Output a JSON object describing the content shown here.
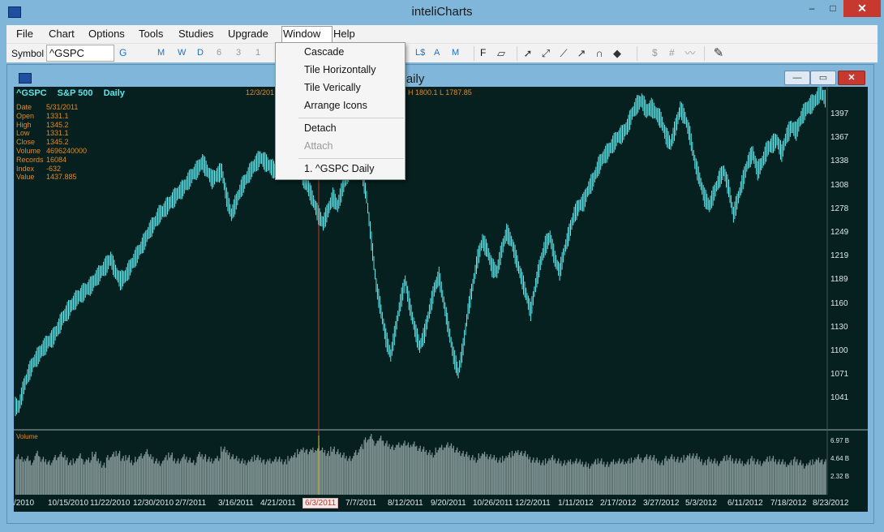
{
  "window": {
    "title": "inteliCharts",
    "minimize": "–",
    "maximize": "□",
    "close": "✕"
  },
  "menu": [
    "File",
    "Chart",
    "Options",
    "Tools",
    "Studies",
    "Upgrade",
    "Window",
    "Help"
  ],
  "toolbar": {
    "symbol_label": "Symbol",
    "symbol_value": "^GSPC",
    "go": "G",
    "periods": [
      "M",
      "W",
      "D"
    ],
    "intervals": [
      "6",
      "3",
      "1"
    ],
    "scale_buttons": [
      "L$",
      "A",
      "M"
    ],
    "format_button": "F",
    "money_button": "$",
    "number_button": "#"
  },
  "chart_window": {
    "title": "C Daily",
    "min": "—",
    "restore": "▭",
    "close": "✕"
  },
  "window_menu": {
    "items": [
      "Cascade",
      "Tile Horizontally",
      "Tile Verically",
      "Arrange Icons",
      "Detach",
      "Attach",
      "1. ^GSPC Daily"
    ],
    "disabled": [
      "Attach"
    ]
  },
  "chart_header": {
    "symbol": "^GSPC",
    "name": "S&P 500",
    "period": "Daily",
    "date_fragment": "12/3/201",
    "ohlc_fragment": "H 1800.1  L 1787.85"
  },
  "info": [
    {
      "key": "Date",
      "value": "5/31/2011"
    },
    {
      "key": "Open",
      "value": "1331.1"
    },
    {
      "key": "High",
      "value": "1345.2"
    },
    {
      "key": "Low",
      "value": "1331.1"
    },
    {
      "key": "Close",
      "value": "1345.2"
    },
    {
      "key": "Volume",
      "value": "4696240000"
    },
    {
      "key": "Records",
      "value": "16084"
    },
    {
      "key": "Index",
      "value": "-632"
    },
    {
      "key": "Value",
      "value": "1437.885"
    }
  ],
  "volume_label": "Volume",
  "chart_data": {
    "type": "bar",
    "y_ticks": [
      "1397",
      "1367",
      "1338",
      "1308",
      "1278",
      "1249",
      "1219",
      "1189",
      "1160",
      "1130",
      "1100",
      "1071",
      "1041"
    ],
    "volume_ticks": [
      "6.97 B",
      "4.64 B",
      "2.32 B"
    ],
    "x_ticks": [
      "/2010",
      "10/15/2010",
      "11/22/2010",
      "12/30/2010",
      "2/7/2011",
      "3/16/2011",
      "4/21/2011",
      "6/3/2011",
      "7/7/2011",
      "8/12/2011",
      "9/20/2011",
      "10/26/2011",
      "12/2/2011",
      "1/11/2012",
      "2/17/2012",
      "3/27/2012",
      "5/3/2012",
      "6/11/2012",
      "7/18/2012",
      "8/23/2012"
    ],
    "highlighted_x": "6/3/2011",
    "price_series": [
      1062,
      1085,
      1100,
      1112,
      1120,
      1128,
      1135,
      1140,
      1150,
      1162,
      1170,
      1178,
      1185,
      1190,
      1195,
      1200,
      1208,
      1215,
      1222,
      1230,
      1215,
      1205,
      1210,
      1220,
      1230,
      1240,
      1250,
      1262,
      1270,
      1280,
      1285,
      1292,
      1298,
      1305,
      1310,
      1318,
      1326,
      1332,
      1340,
      1330,
      1320,
      1325,
      1330,
      1300,
      1280,
      1295,
      1310,
      1320,
      1330,
      1338,
      1345,
      1340,
      1335,
      1330,
      1340,
      1345,
      1350,
      1345,
      1338,
      1320,
      1310,
      1295,
      1280,
      1270,
      1285,
      1300,
      1290,
      1310,
      1325,
      1338,
      1344,
      1330,
      1300,
      1250,
      1200,
      1170,
      1140,
      1120,
      1150,
      1180,
      1205,
      1175,
      1150,
      1130,
      1145,
      1170,
      1195,
      1210,
      1180,
      1150,
      1120,
      1100,
      1130,
      1170,
      1200,
      1230,
      1250,
      1240,
      1220,
      1215,
      1240,
      1260,
      1250,
      1230,
      1210,
      1190,
      1170,
      1200,
      1225,
      1245,
      1255,
      1230,
      1215,
      1240,
      1260,
      1280,
      1290,
      1295,
      1310,
      1320,
      1335,
      1345,
      1352,
      1360,
      1368,
      1372,
      1380,
      1395,
      1405,
      1410,
      1398,
      1402,
      1395,
      1388,
      1370,
      1360,
      1380,
      1400,
      1390,
      1370,
      1340,
      1320,
      1300,
      1290,
      1305,
      1320,
      1330,
      1310,
      1280,
      1300,
      1320,
      1340,
      1350,
      1330,
      1340,
      1355,
      1360,
      1365,
      1350,
      1370,
      1380,
      1375,
      1390,
      1400,
      1405,
      1410,
      1420,
      1412
    ],
    "volume_series": [
      4.6,
      4.1,
      4.3,
      3.9,
      4.8,
      4.2,
      4.0,
      3.7,
      4.4,
      4.9,
      4.3,
      3.8,
      4.1,
      4.5,
      3.9,
      4.2,
      4.7,
      4.0,
      3.6,
      4.3,
      4.8,
      5.0,
      4.2,
      4.4,
      3.9,
      4.1,
      4.6,
      5.2,
      4.4,
      4.0,
      3.8,
      4.3,
      4.7,
      4.1,
      3.9,
      4.5,
      4.2,
      3.7,
      4.8,
      4.6,
      4.1,
      4.0,
      4.4,
      5.3,
      5.0,
      4.6,
      4.2,
      4.0,
      3.9,
      4.1,
      4.4,
      4.2,
      3.8,
      4.0,
      4.3,
      4.1,
      3.9,
      4.4,
      4.6,
      5.1,
      5.4,
      5.0,
      5.3,
      5.6,
      5.2,
      4.9,
      5.5,
      5.0,
      4.7,
      4.4,
      4.2,
      5.0,
      5.8,
      6.4,
      6.9,
      6.2,
      6.6,
      6.1,
      5.8,
      5.5,
      5.9,
      6.2,
      5.8,
      6.0,
      5.6,
      5.3,
      5.0,
      4.8,
      5.2,
      5.6,
      6.0,
      5.7,
      5.3,
      5.0,
      4.7,
      4.4,
      4.2,
      4.5,
      4.8,
      4.6,
      4.3,
      4.1,
      4.4,
      4.6,
      4.9,
      5.1,
      4.8,
      4.5,
      4.2,
      4.0,
      3.8,
      4.1,
      4.3,
      4.0,
      3.8,
      3.7,
      3.9,
      4.1,
      3.8,
      3.6,
      3.5,
      3.8,
      4.0,
      3.7,
      3.5,
      3.9,
      4.1,
      3.8,
      4.0,
      4.2,
      4.4,
      4.1,
      4.6,
      4.3,
      4.0,
      3.9,
      4.2,
      4.5,
      4.3,
      4.0,
      4.4,
      4.7,
      4.5,
      4.2,
      3.9,
      4.1,
      4.0,
      3.8,
      4.2,
      4.4,
      4.1,
      3.9,
      3.7,
      4.0,
      4.2,
      3.9,
      3.8,
      4.1,
      4.3,
      4.0,
      3.8,
      3.6,
      3.9,
      4.1,
      3.8,
      3.5,
      3.7,
      3.9,
      4.2,
      3.8
    ]
  },
  "colors": {
    "plot_bg": "#061f1f",
    "price_bar": "#5de6ea",
    "volume_bar": "#7f9292",
    "cursor_line": "#c0392b",
    "accent_orange": "#e48a20"
  }
}
